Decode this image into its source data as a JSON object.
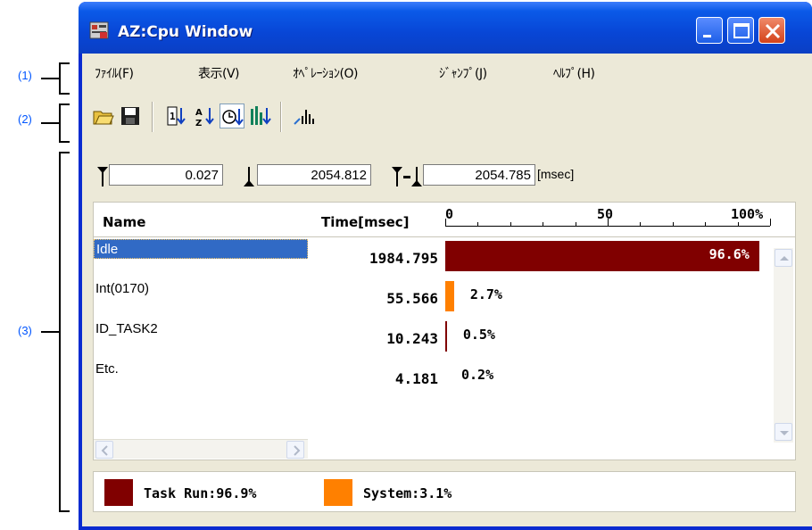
{
  "window": {
    "title": "AZ:Cpu Window"
  },
  "callouts": [
    "(1)",
    "(2)",
    "(3)"
  ],
  "menu": [
    "ﾌｧｲﾙ(F)",
    "表示(V)",
    "ｵﾍﾟﾚｰｼｮﾝ(O)",
    "ｼﾞｬﾝﾌﾟ(J)",
    "ﾍﾙﾌﾟ(H)"
  ],
  "toolbar": [
    "open-icon",
    "save-icon",
    "sort-number-icon",
    "sort-alpha-icon",
    "sort-time-icon",
    "sort-graph-icon",
    "bar-chart-icon"
  ],
  "range": {
    "start": "0.027",
    "end": "2054.812",
    "span": "2054.785",
    "unit": "[msec]"
  },
  "header": {
    "name": "Name",
    "time": "Time[msec]"
  },
  "scale": {
    "ticks": [
      "0",
      "50",
      "100%"
    ]
  },
  "rows": [
    {
      "name": "Idle",
      "time": "1984.795",
      "pct_label": "96.6%",
      "pct": 96.6,
      "color": "#800000"
    },
    {
      "name": "Int(0170)",
      "time": "55.566",
      "pct_label": "2.7%",
      "pct": 2.7,
      "color": "#ff8000"
    },
    {
      "name": "ID_TASK2",
      "time": "10.243",
      "pct_label": "0.5%",
      "pct": 0.5,
      "color": "#800000"
    },
    {
      "name": "Etc.",
      "time": "4.181",
      "pct_label": "0.2%",
      "pct": 0.2,
      "color": "#800000"
    }
  ],
  "legend": [
    {
      "label": "Task Run:96.9%",
      "color": "#800000"
    },
    {
      "label": "System:3.1%",
      "color": "#ff8000"
    }
  ]
}
